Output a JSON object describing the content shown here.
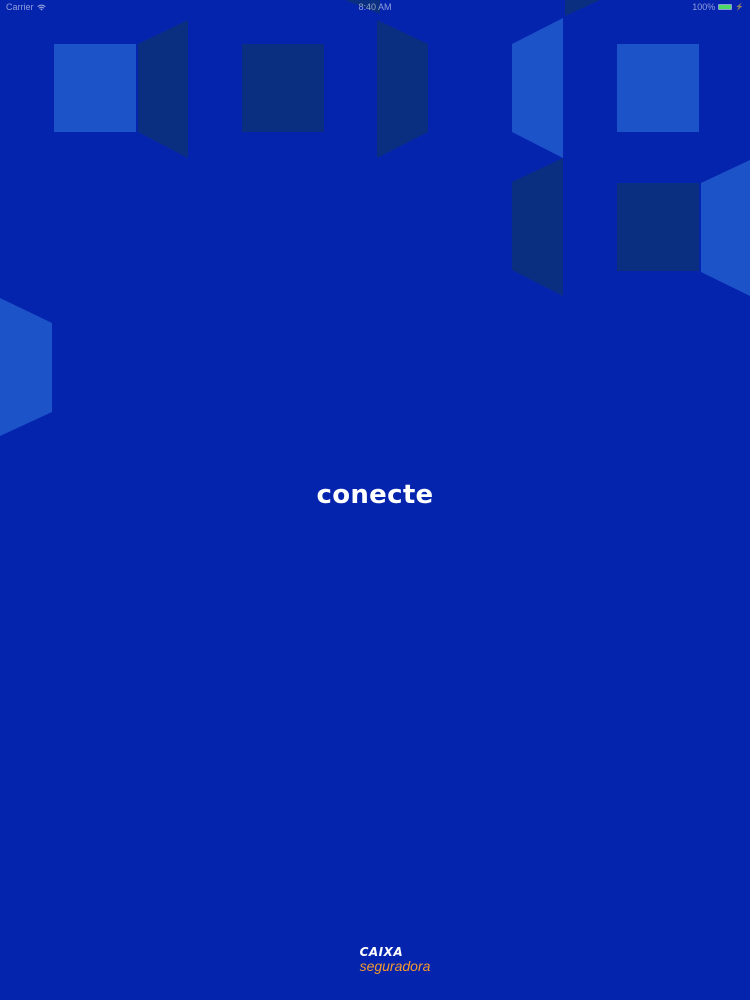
{
  "status_bar": {
    "carrier": "Carrier",
    "time": "8:40 AM",
    "battery_percent_text": "100%",
    "battery_level": 1.0,
    "wifi_icon": "wifi-icon",
    "battery_icon": "battery-icon"
  },
  "splash": {
    "title": "conecte"
  },
  "footer": {
    "logo_top": "CAIXA",
    "logo_bottom": "seguradora"
  },
  "colors": {
    "background": "#0524AE",
    "shape_light": "#1D53C9",
    "shape_dark": "#0A2F80",
    "logo_accent": "#F39A2E"
  }
}
